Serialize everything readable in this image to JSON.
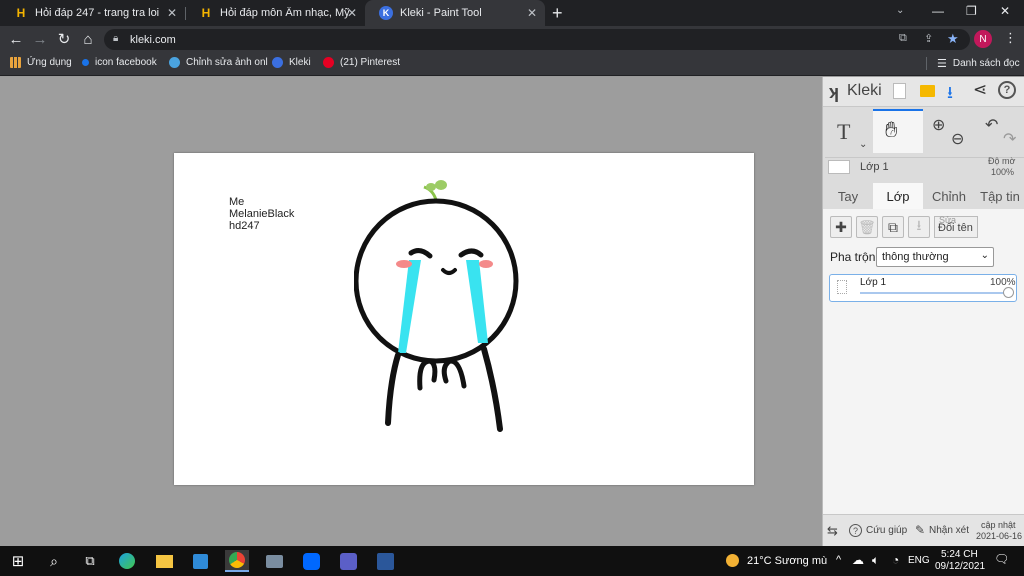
{
  "browser": {
    "tabs": [
      {
        "title": "Hỏi đáp 247 - trang tra loi",
        "icon": "H"
      },
      {
        "title": "Hỏi đáp môn Âm nhạc, Mỹ thuật",
        "icon": "H"
      },
      {
        "title": "Kleki - Paint Tool",
        "icon": "K"
      }
    ],
    "new_tab": "+",
    "url": "kleki.com",
    "profile_initial": "N",
    "bookmarks": [
      {
        "label": "Ứng dụng",
        "color": "#e8a33d"
      },
      {
        "label": "icon facebook",
        "color": "#1a73e8"
      },
      {
        "label": "Chỉnh sửa ảnh onl",
        "color": "#4aa3df"
      },
      {
        "label": "Kleki",
        "color": "#3b6fe0"
      },
      {
        "label": "(21) Pinterest",
        "color": "#e60023"
      }
    ],
    "reading_list": "Danh sách đọc"
  },
  "canvas": {
    "lines": [
      "Me",
      "MelanieBlack",
      "hd247"
    ]
  },
  "panel": {
    "brand": "Kleki",
    "tools": {
      "text": "T"
    },
    "layer_name": "Lớp 1",
    "opacity_label": "Độ mờ",
    "opacity_value": "100%",
    "tabs": [
      "Tay",
      "Lớp",
      "Chỉnh",
      "Tập tin"
    ],
    "active_tab": "Lớp",
    "rename_label_top": "Sửa",
    "rename_label": "Đổi tên",
    "blend_label": "Pha trộn",
    "blend_value": "thông thường",
    "layer_item": {
      "name": "Lớp 1",
      "opacity": "100%",
      "opacity_fraction": 1.0
    },
    "help": "Cứu giúp",
    "comment": "Nhận xét",
    "update_label": "cập nhật",
    "update_date": "2021-06-16"
  },
  "taskbar": {
    "weather": "21°C  Sương mù",
    "lang": "ENG",
    "time": "5:24 CH",
    "date": "09/12/2021"
  }
}
